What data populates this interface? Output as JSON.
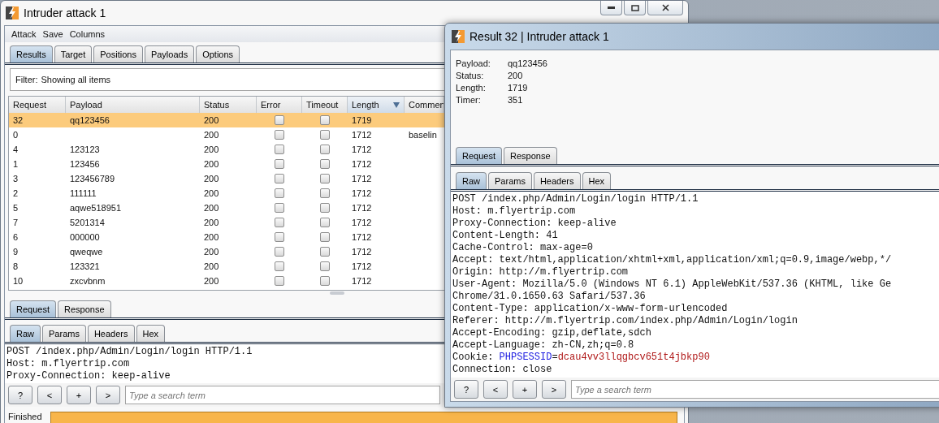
{
  "main_window": {
    "title": "Intruder attack 1",
    "menu": [
      "Attack",
      "Save",
      "Columns"
    ],
    "tabs": [
      {
        "label": "Results",
        "selected": true
      },
      {
        "label": "Target",
        "selected": false
      },
      {
        "label": "Positions",
        "selected": false
      },
      {
        "label": "Payloads",
        "selected": false
      },
      {
        "label": "Options",
        "selected": false
      }
    ],
    "filter": {
      "label": "Filter:",
      "value": "Showing all items"
    },
    "table": {
      "columns": [
        {
          "label": "Request",
          "sorted": false
        },
        {
          "label": "Payload",
          "sorted": false
        },
        {
          "label": "Status",
          "sorted": false
        },
        {
          "label": "Error",
          "sorted": false
        },
        {
          "label": "Timeout",
          "sorted": false
        },
        {
          "label": "Length",
          "sorted": true
        },
        {
          "label": "Commen",
          "sorted": false
        }
      ],
      "rows": [
        {
          "request": "32",
          "payload": "qq123456",
          "status": "200",
          "error": false,
          "timeout": false,
          "length": "1719",
          "comment": "",
          "selected": true
        },
        {
          "request": "0",
          "payload": "",
          "status": "200",
          "error": false,
          "timeout": false,
          "length": "1712",
          "comment": "baselin",
          "selected": false
        },
        {
          "request": "4",
          "payload": "123123",
          "status": "200",
          "error": false,
          "timeout": false,
          "length": "1712",
          "comment": "",
          "selected": false
        },
        {
          "request": "1",
          "payload": "123456",
          "status": "200",
          "error": false,
          "timeout": false,
          "length": "1712",
          "comment": "",
          "selected": false
        },
        {
          "request": "3",
          "payload": "123456789",
          "status": "200",
          "error": false,
          "timeout": false,
          "length": "1712",
          "comment": "",
          "selected": false
        },
        {
          "request": "2",
          "payload": "111111",
          "status": "200",
          "error": false,
          "timeout": false,
          "length": "1712",
          "comment": "",
          "selected": false
        },
        {
          "request": "5",
          "payload": "aqwe518951",
          "status": "200",
          "error": false,
          "timeout": false,
          "length": "1712",
          "comment": "",
          "selected": false
        },
        {
          "request": "7",
          "payload": "5201314",
          "status": "200",
          "error": false,
          "timeout": false,
          "length": "1712",
          "comment": "",
          "selected": false
        },
        {
          "request": "6",
          "payload": "000000",
          "status": "200",
          "error": false,
          "timeout": false,
          "length": "1712",
          "comment": "",
          "selected": false
        },
        {
          "request": "9",
          "payload": "qweqwe",
          "status": "200",
          "error": false,
          "timeout": false,
          "length": "1712",
          "comment": "",
          "selected": false
        },
        {
          "request": "8",
          "payload": "123321",
          "status": "200",
          "error": false,
          "timeout": false,
          "length": "1712",
          "comment": "",
          "selected": false
        },
        {
          "request": "10",
          "payload": "zxcvbnm",
          "status": "200",
          "error": false,
          "timeout": false,
          "length": "1712",
          "comment": "",
          "selected": false
        }
      ]
    },
    "message_tabs": [
      {
        "label": "Request",
        "selected": true
      },
      {
        "label": "Response",
        "selected": false
      }
    ],
    "view_tabs": [
      {
        "label": "Raw",
        "selected": true
      },
      {
        "label": "Params",
        "selected": false
      },
      {
        "label": "Headers",
        "selected": false
      },
      {
        "label": "Hex",
        "selected": false
      }
    ],
    "request_lines": [
      {
        "kind": "plain",
        "text": "POST /index.php/Admin/Login/login HTTP/1.1"
      },
      {
        "kind": "plain",
        "text": "Host: m.flyertrip.com"
      },
      {
        "kind": "plain",
        "text": "Proxy-Connection: keep-alive"
      }
    ],
    "search_buttons": [
      "?",
      "<",
      "+",
      ">"
    ],
    "search": {
      "placeholder": "Type a search term"
    },
    "status": {
      "text": "Finished",
      "level": 1
    }
  },
  "result_window": {
    "title": "Result 32 | Intruder attack 1",
    "details": [
      {
        "label": "Payload:",
        "value": "qq123456"
      },
      {
        "label": "Status:",
        "value": "200"
      },
      {
        "label": "Length:",
        "value": "1719"
      },
      {
        "label": "Timer:",
        "value": "351"
      }
    ],
    "message_tabs": [
      {
        "label": "Request",
        "selected": true
      },
      {
        "label": "Response",
        "selected": false
      }
    ],
    "view_tabs": [
      {
        "label": "Raw",
        "selected": true
      },
      {
        "label": "Params",
        "selected": false
      },
      {
        "label": "Headers",
        "selected": false
      },
      {
        "label": "Hex",
        "selected": false
      }
    ],
    "request_lines": [
      {
        "kind": "plain",
        "text": "POST /index.php/Admin/Login/login HTTP/1.1"
      },
      {
        "kind": "plain",
        "text": "Host: m.flyertrip.com"
      },
      {
        "kind": "plain",
        "text": "Proxy-Connection: keep-alive"
      },
      {
        "kind": "plain",
        "text": "Content-Length: 41"
      },
      {
        "kind": "plain",
        "text": "Cache-Control: max-age=0"
      },
      {
        "kind": "plain",
        "text": "Accept: text/html,application/xhtml+xml,application/xml;q=0.9,image/webp,*/"
      },
      {
        "kind": "plain",
        "text": "Origin: http://m.flyertrip.com"
      },
      {
        "kind": "plain",
        "text": "User-Agent: Mozilla/5.0 (Windows NT 6.1) AppleWebKit/537.36 (KHTML, like Ge"
      },
      {
        "kind": "plain",
        "text": "Chrome/31.0.1650.63 Safari/537.36"
      },
      {
        "kind": "plain",
        "text": "Content-Type: application/x-www-form-urlencoded"
      },
      {
        "kind": "plain",
        "text": "Referer: http://m.flyertrip.com/index.php/Admin/Login/login"
      },
      {
        "kind": "plain",
        "text": "Accept-Encoding: gzip,deflate,sdch"
      },
      {
        "kind": "plain",
        "text": "Accept-Language: zh-CN,zh;q=0.8"
      },
      {
        "kind": "cookie",
        "label": "Cookie:",
        "name": "PHPSESSID",
        "sep": "=",
        "value": "dcau4vv3llqgbcv651t4jbkp90"
      },
      {
        "kind": "plain",
        "text": "Connection: close"
      }
    ],
    "search_buttons": [
      "?",
      "<",
      "+",
      ">"
    ],
    "search": {
      "placeholder": "Type a search term"
    }
  }
}
